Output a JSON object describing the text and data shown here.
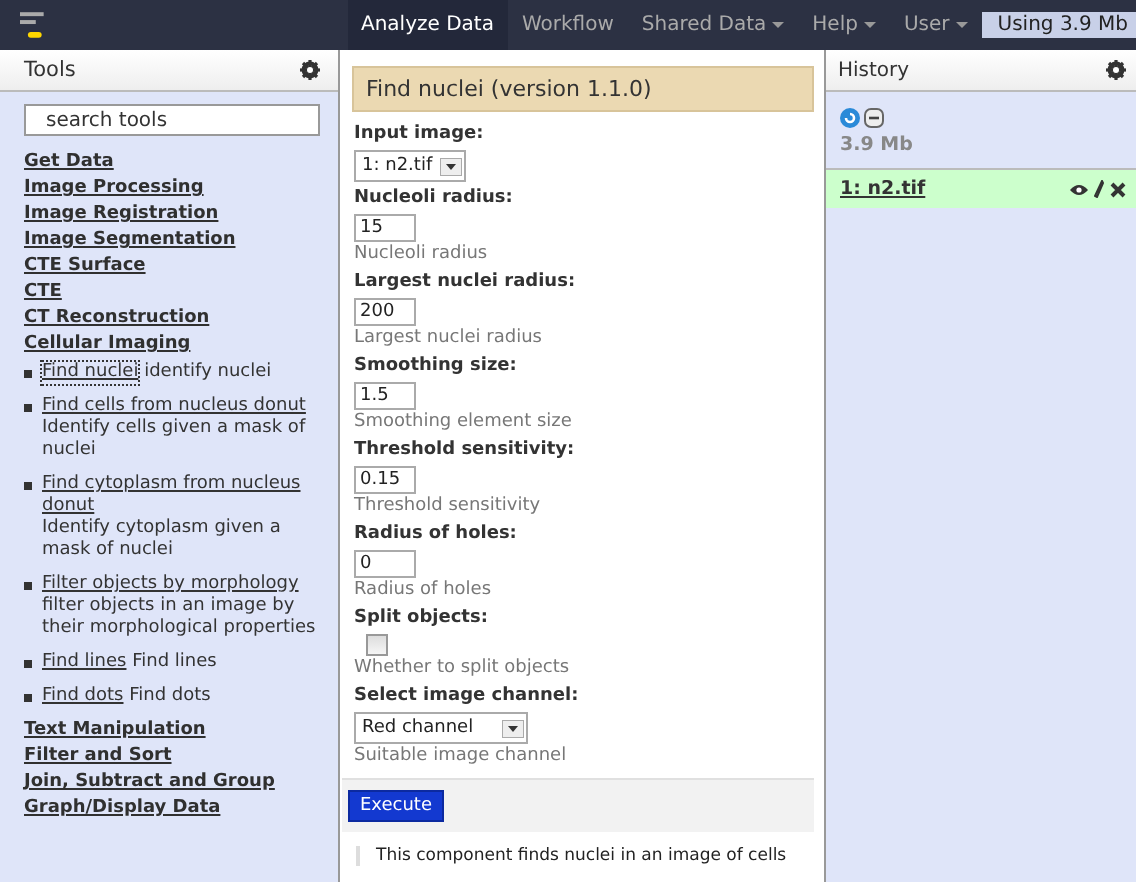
{
  "masthead": {
    "nav": [
      {
        "label": "Analyze Data",
        "selected": true,
        "dropdown": false
      },
      {
        "label": "Workflow",
        "selected": false,
        "dropdown": false
      },
      {
        "label": "Shared Data",
        "selected": false,
        "dropdown": true
      },
      {
        "label": "Help",
        "selected": false,
        "dropdown": true
      },
      {
        "label": "User",
        "selected": false,
        "dropdown": true
      }
    ],
    "usage": "Using 3.9 Mb"
  },
  "tools": {
    "title": "Tools",
    "search": {
      "placeholder": "search tools"
    },
    "sections": [
      {
        "label": "Get Data"
      },
      {
        "label": "Image Processing"
      },
      {
        "label": "Image Registration"
      },
      {
        "label": "Image Segmentation"
      },
      {
        "label": "CTE Surface"
      },
      {
        "label": "CTE"
      },
      {
        "label": "CT Reconstruction"
      },
      {
        "label": "Cellular Imaging",
        "tools": [
          {
            "name": "Find nuclei",
            "description": "identify nuclei",
            "selected": true
          },
          {
            "name": "Find cells from nucleus donut",
            "description": "Identify cells given a mask of nuclei",
            "selected": false
          },
          {
            "name": "Find cytoplasm from nucleus donut",
            "description": "Identify cytoplasm given a mask of nuclei",
            "selected": false
          },
          {
            "name": "Filter objects by morphology",
            "description": "filter objects in an image by their morphological properties",
            "selected": false
          },
          {
            "name": "Find lines",
            "description": "Find lines",
            "selected": false
          },
          {
            "name": "Find dots",
            "description": "Find dots",
            "selected": false
          }
        ]
      },
      {
        "label": "Text Manipulation"
      },
      {
        "label": "Filter and Sort"
      },
      {
        "label": "Join, Subtract and Group"
      },
      {
        "label": "Graph/Display Data"
      }
    ]
  },
  "form": {
    "title": "Find nuclei (version 1.1.0)",
    "params": [
      {
        "kind": "select",
        "label": "Input image:",
        "value": "1: n2.tif"
      },
      {
        "kind": "text",
        "label": "Nucleoli radius:",
        "value": "15",
        "help": "Nucleoli radius"
      },
      {
        "kind": "text",
        "label": "Largest nuclei radius:",
        "value": "200",
        "help": "Largest nuclei radius"
      },
      {
        "kind": "text",
        "label": "Smoothing size:",
        "value": "1.5",
        "help": "Smoothing element size"
      },
      {
        "kind": "text",
        "label": "Threshold sensitivity:",
        "value": "0.15",
        "help": "Threshold sensitivity"
      },
      {
        "kind": "text",
        "label": "Radius of holes:",
        "value": "0",
        "help": "Radius of holes"
      },
      {
        "kind": "checkbox",
        "label": "Split objects:",
        "checked": false,
        "help": "Whether to split objects"
      },
      {
        "kind": "select",
        "label": "Select image channel:",
        "value": "Red channel",
        "help": "Suitable image channel"
      }
    ],
    "execute": "Execute",
    "description": "This component finds nuclei in an image of cells"
  },
  "history": {
    "title": "History",
    "size": "3.9 Mb",
    "items": [
      {
        "name": "1: n2.tif"
      }
    ]
  }
}
